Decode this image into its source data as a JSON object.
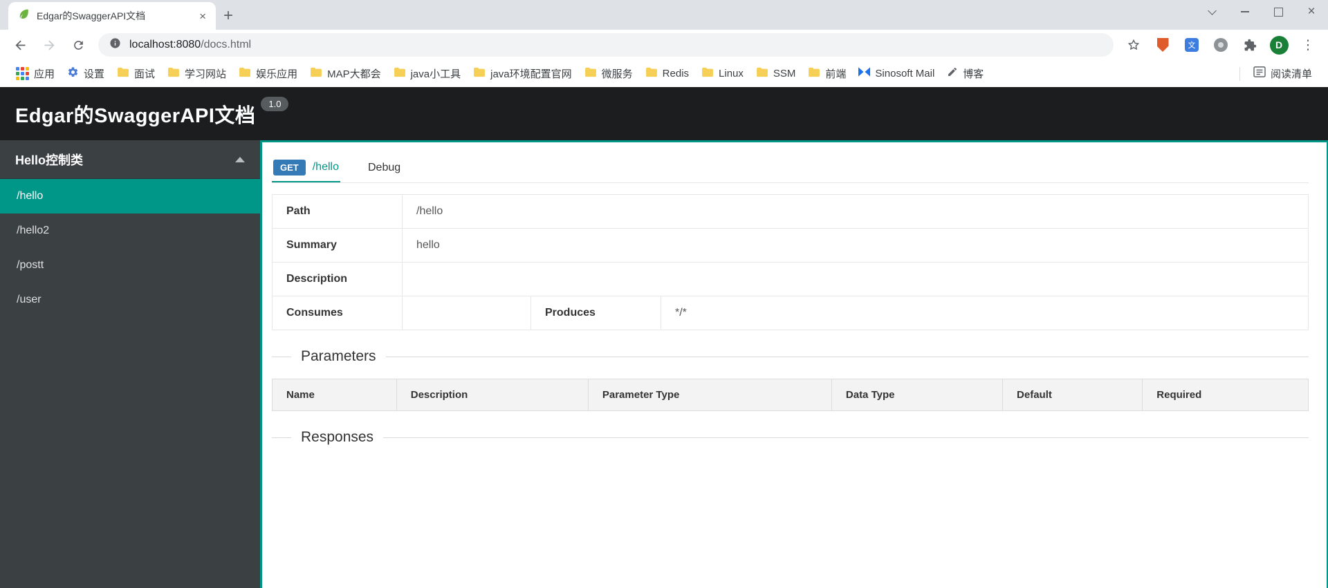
{
  "browser": {
    "tab_title": "Edgar的SwaggerAPI文档",
    "url": {
      "host": "localhost:8080",
      "path": "/docs.html"
    },
    "avatar_letter": "D",
    "glyphs": {
      "tab_close": "×",
      "new_tab": "+",
      "window_close": "×",
      "menu_dots": "⋮",
      "translate_glyph": "文"
    },
    "bookmarks_bar": {
      "items": [
        {
          "label": "应用",
          "icon": "apps-grid-icon"
        },
        {
          "label": "设置",
          "icon": "gear-icon"
        },
        {
          "label": "面试",
          "icon": "folder-icon"
        },
        {
          "label": "学习网站",
          "icon": "folder-icon"
        },
        {
          "label": "娱乐应用",
          "icon": "folder-icon"
        },
        {
          "label": "MAP大都会",
          "icon": "folder-icon"
        },
        {
          "label": "java小工具",
          "icon": "folder-icon"
        },
        {
          "label": "java环境配置官网",
          "icon": "folder-icon"
        },
        {
          "label": "微服务",
          "icon": "folder-icon"
        },
        {
          "label": "Redis",
          "icon": "folder-icon"
        },
        {
          "label": "Linux",
          "icon": "folder-icon"
        },
        {
          "label": "SSM",
          "icon": "folder-icon"
        },
        {
          "label": "前端",
          "icon": "folder-icon"
        },
        {
          "label": "Sinosoft Mail",
          "icon": "mail-icon"
        },
        {
          "label": "博客",
          "icon": "pen-icon"
        }
      ],
      "reading_list": "阅读清单"
    }
  },
  "page": {
    "header": {
      "title": "Edgar的SwaggerAPI文档",
      "version_badge": "1.0"
    },
    "sidebar": {
      "group_label": "Hello控制类",
      "items": [
        {
          "label": "/hello",
          "active": true
        },
        {
          "label": "/hello2",
          "active": false
        },
        {
          "label": "/postt",
          "active": false
        },
        {
          "label": "/user",
          "active": false
        }
      ]
    },
    "main": {
      "operation_tab": {
        "method": "GET",
        "path": "/hello"
      },
      "debug_tab": "Debug",
      "info": {
        "path_label": "Path",
        "path_value": "/hello",
        "summary_label": "Summary",
        "summary_value": "hello",
        "description_label": "Description",
        "description_value": "",
        "consumes_label": "Consumes",
        "consumes_value": "",
        "produces_label": "Produces",
        "produces_value": "*/*"
      },
      "parameters": {
        "title": "Parameters",
        "columns": [
          "Name",
          "Description",
          "Parameter Type",
          "Data Type",
          "Default",
          "Required"
        ],
        "rows": []
      },
      "responses": {
        "title": "Responses"
      }
    }
  },
  "colors": {
    "accent_teal": "#009688",
    "get_badge_blue": "#337ab7",
    "header_dark": "#1b1d1e",
    "sidebar_dark": "#3b4043"
  }
}
